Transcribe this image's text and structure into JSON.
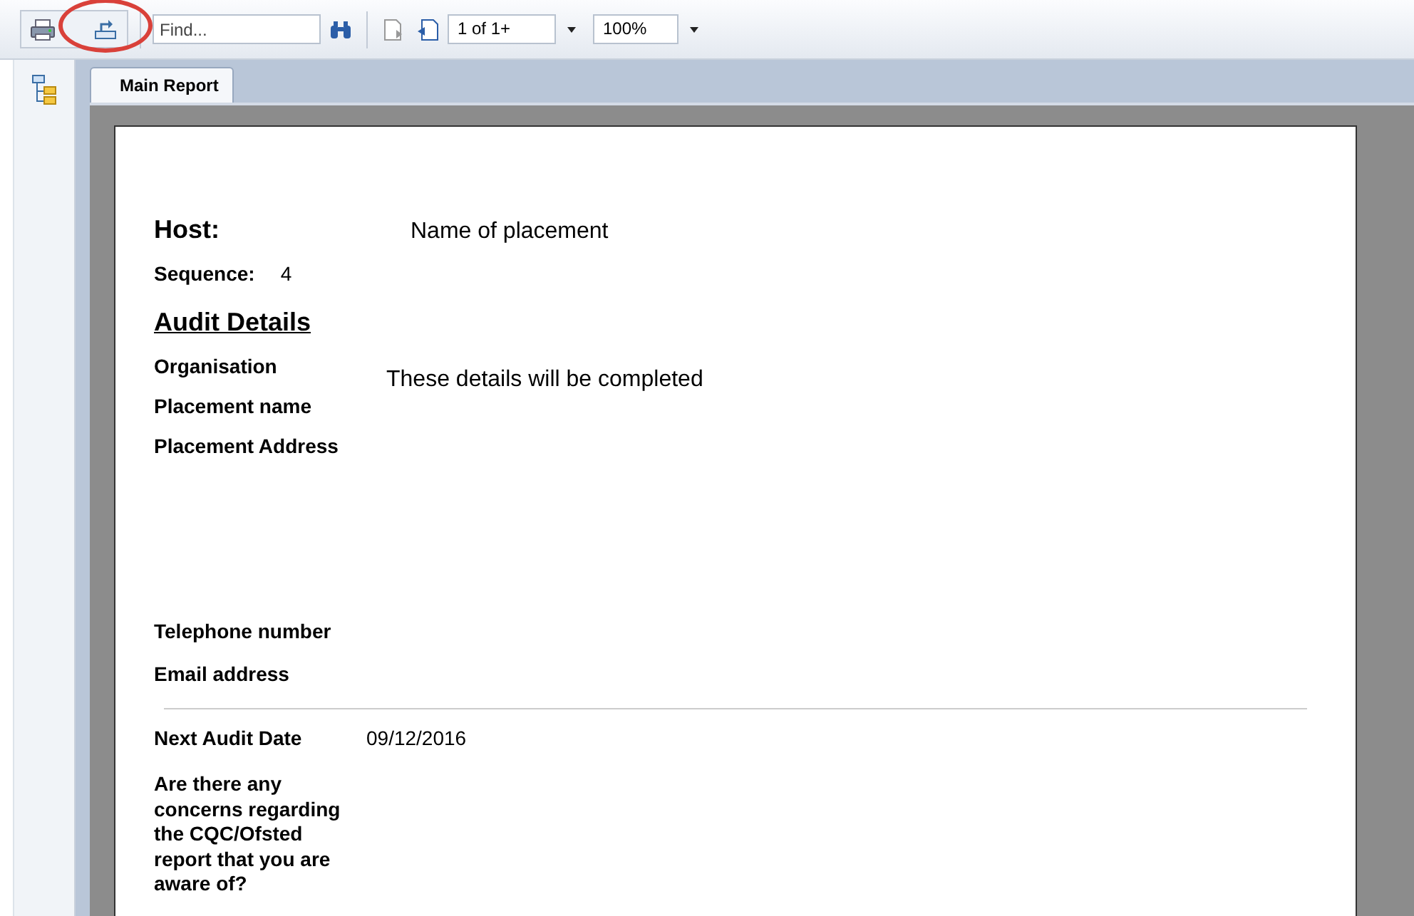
{
  "toolbar": {
    "buttons": [
      {
        "kind": "print",
        "circled": false
      },
      {
        "kind": "export",
        "circled": true
      }
    ],
    "find": {
      "placeholder": "Find..."
    },
    "page": "1 of 1+",
    "zoom": "100%"
  },
  "tabs": [
    {
      "label": "Main Report",
      "selected": true
    }
  ],
  "report": {
    "host_label": "Host:",
    "host_value": "Name of placement",
    "sequence_label": "Sequence:",
    "sequence_value": "4",
    "section_title": "Audit Details",
    "details_fields": [
      {
        "label": "Organisation"
      },
      {
        "label": "Placement name"
      },
      {
        "label": "Placement Address"
      }
    ],
    "details_note": "These details will be completed",
    "contact_fields": [
      {
        "label": "Telephone number"
      },
      {
        "label": "Email address"
      }
    ],
    "next_audit": {
      "label": "Next Audit Date",
      "value": "09/12/2016"
    },
    "question": "Are there any concerns regarding the CQC/Ofsted report that you are aware of?"
  }
}
